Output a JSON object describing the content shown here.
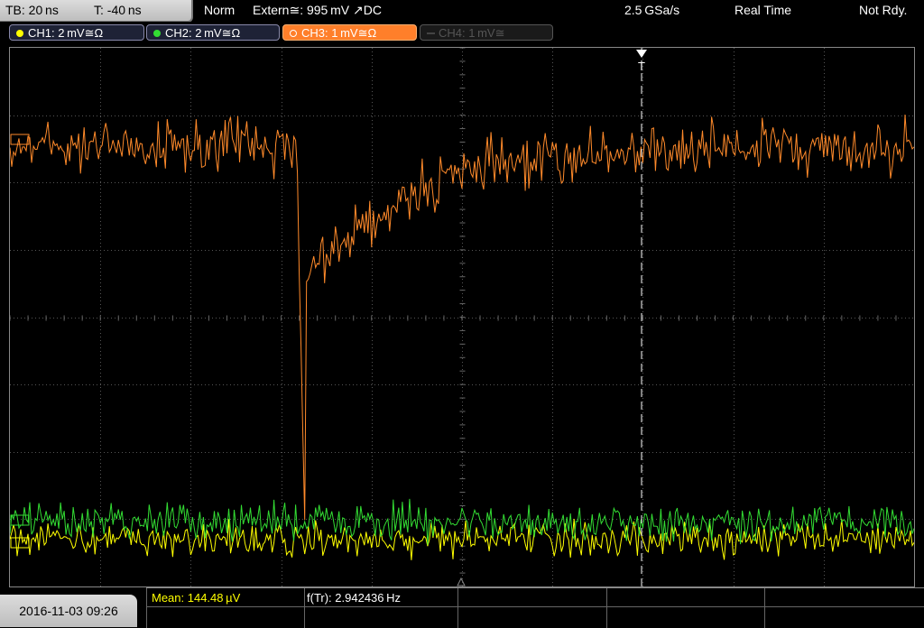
{
  "header": {
    "timebase": "TB: 20 ns",
    "trigger_time": "T: -40 ns",
    "trigger_mode": "Norm",
    "trigger_source": "Extern≅: 995 mV ↗DC",
    "sample_rate": "2.5 GSa/s",
    "acq_mode": "Real Time",
    "status": "Not Rdy."
  },
  "channels": [
    {
      "label": "CH1: 2 mV≅Ω",
      "color": "#ffff00",
      "active": true
    },
    {
      "label": "CH2: 2 mV≅Ω",
      "color": "#33dd33",
      "active": true
    },
    {
      "label": "CH3: 1 mV≅Ω",
      "color": "#ff8a2a",
      "active": true,
      "selected": true
    },
    {
      "label": "CH4: 1 mV≅",
      "color": "#666666",
      "active": false
    }
  ],
  "footer": {
    "datetime": "2016-11-03 09:26",
    "mean": "Mean: 144.48 µV",
    "freq": "f(Tr): 2.942436 Hz"
  },
  "trigger_marker": "T",
  "colors": {
    "ch1": "#ffff00",
    "ch2": "#33dd33",
    "ch3": "#ff8a2a",
    "grid": "#555555"
  }
}
